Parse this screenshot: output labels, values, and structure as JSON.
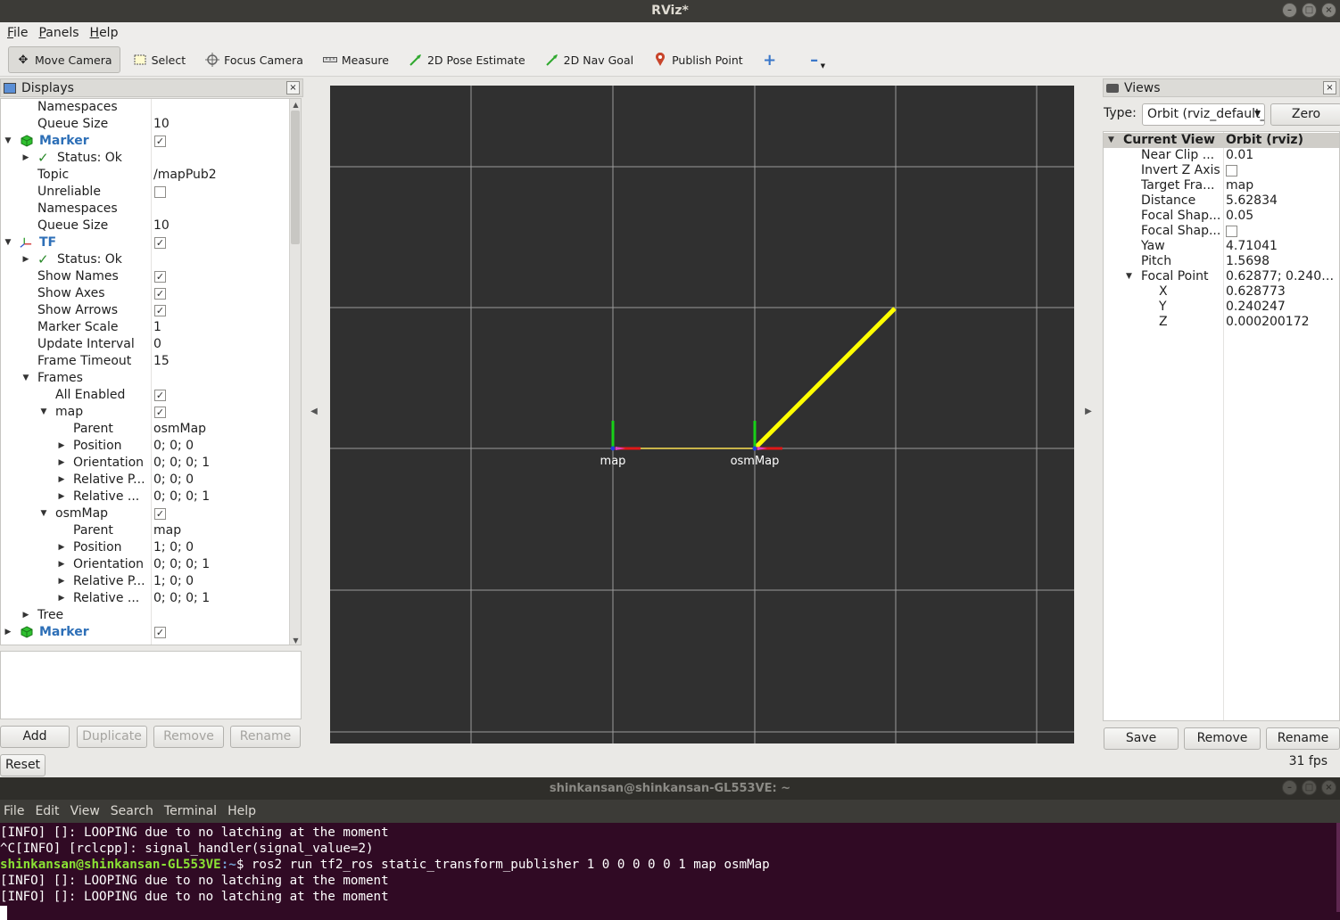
{
  "window": {
    "title": "RViz*"
  },
  "menu": {
    "file": "File",
    "file_u": "F",
    "file_rest": "ile",
    "panels_u": "P",
    "panels_rest": "anels",
    "help_u": "H",
    "help_rest": "elp"
  },
  "toolbar": {
    "move_camera": "Move Camera",
    "select": "Select",
    "focus_camera": "Focus Camera",
    "measure": "Measure",
    "pose_estimate": "2D Pose Estimate",
    "nav_goal": "2D Nav Goal",
    "publish_point": "Publish Point"
  },
  "displays": {
    "title": "Displays",
    "rows": [
      {
        "name": "Namespaces",
        "value": ""
      },
      {
        "name": "Queue Size",
        "value": "10"
      },
      {
        "name": "Marker",
        "value": ""
      },
      {
        "name": "Status: Ok",
        "value": ""
      },
      {
        "name": "Topic",
        "value": "/mapPub2"
      },
      {
        "name": "Unreliable",
        "value": ""
      },
      {
        "name": "Namespaces",
        "value": ""
      },
      {
        "name": "Queue Size",
        "value": "10"
      },
      {
        "name": "TF",
        "value": ""
      },
      {
        "name": "Status: Ok",
        "value": ""
      },
      {
        "name": "Show Names",
        "value": ""
      },
      {
        "name": "Show Axes",
        "value": ""
      },
      {
        "name": "Show Arrows",
        "value": ""
      },
      {
        "name": "Marker Scale",
        "value": "1"
      },
      {
        "name": "Update Interval",
        "value": "0"
      },
      {
        "name": "Frame Timeout",
        "value": "15"
      },
      {
        "name": "Frames",
        "value": ""
      },
      {
        "name": "All Enabled",
        "value": ""
      },
      {
        "name": "map",
        "value": ""
      },
      {
        "name": "Parent",
        "value": "osmMap"
      },
      {
        "name": "Position",
        "value": "0; 0; 0"
      },
      {
        "name": "Orientation",
        "value": "0; 0; 0; 1"
      },
      {
        "name": "Relative P...",
        "value": "0; 0; 0"
      },
      {
        "name": "Relative ...",
        "value": "0; 0; 0; 1"
      },
      {
        "name": "osmMap",
        "value": ""
      },
      {
        "name": "Parent",
        "value": "map"
      },
      {
        "name": "Position",
        "value": "1; 0; 0"
      },
      {
        "name": "Orientation",
        "value": "0; 0; 0; 1"
      },
      {
        "name": "Relative P...",
        "value": "1; 0; 0"
      },
      {
        "name": "Relative ...",
        "value": "0; 0; 0; 1"
      },
      {
        "name": "Tree",
        "value": ""
      },
      {
        "name": "Marker",
        "value": ""
      }
    ],
    "buttons": {
      "add": "Add",
      "duplicate": "Duplicate",
      "remove": "Remove",
      "rename": "Rename",
      "reset": "Reset"
    }
  },
  "viewport": {
    "frames": [
      {
        "label": "map",
        "x": 0,
        "y": 0
      },
      {
        "label": "osmMap",
        "x": 1,
        "y": 0
      }
    ],
    "marker_color": "#ffff00",
    "background": "#303030"
  },
  "views": {
    "title": "Views",
    "type_label": "Type:",
    "type_value": "Orbit (rviz_default_plugins)",
    "zero": "Zero",
    "header_name": "Current View",
    "header_value": "Orbit (rviz)",
    "rows": [
      {
        "name": "Near Clip ...",
        "value": "0.01"
      },
      {
        "name": "Invert Z Axis",
        "value": ""
      },
      {
        "name": "Target Fra...",
        "value": "map"
      },
      {
        "name": "Distance",
        "value": "5.62834"
      },
      {
        "name": "Focal Shap...",
        "value": "0.05"
      },
      {
        "name": "Focal Shap...",
        "value": ""
      },
      {
        "name": "Yaw",
        "value": "4.71041"
      },
      {
        "name": "Pitch",
        "value": "1.5698"
      },
      {
        "name": "Focal Point",
        "value": "0.62877; 0.2402..."
      },
      {
        "name": "X",
        "value": "0.628773"
      },
      {
        "name": "Y",
        "value": "0.240247"
      },
      {
        "name": "Z",
        "value": "0.000200172"
      }
    ],
    "buttons": {
      "save": "Save",
      "remove": "Remove",
      "rename": "Rename"
    },
    "fps": "31 fps"
  },
  "terminal": {
    "title": "shinkansan@shinkansan-GL553VE: ~",
    "menu": [
      "File",
      "Edit",
      "View",
      "Search",
      "Terminal",
      "Help"
    ],
    "line1": "[INFO] []: LOOPING due to no latching at the moment",
    "line2": "^C[INFO] [rclcpp]: signal_handler(signal_value=2)",
    "prompt_user": "shinkansan@shinkansan-GL553VE",
    "prompt_path": ":~",
    "command": "$ ros2 run tf2_ros static_transform_publisher 1 0 0 0 0 0 1 map osmMap",
    "line4": "[INFO] []: LOOPING due to no latching at the moment",
    "line5": "[INFO] []: LOOPING due to no latching at the moment"
  }
}
